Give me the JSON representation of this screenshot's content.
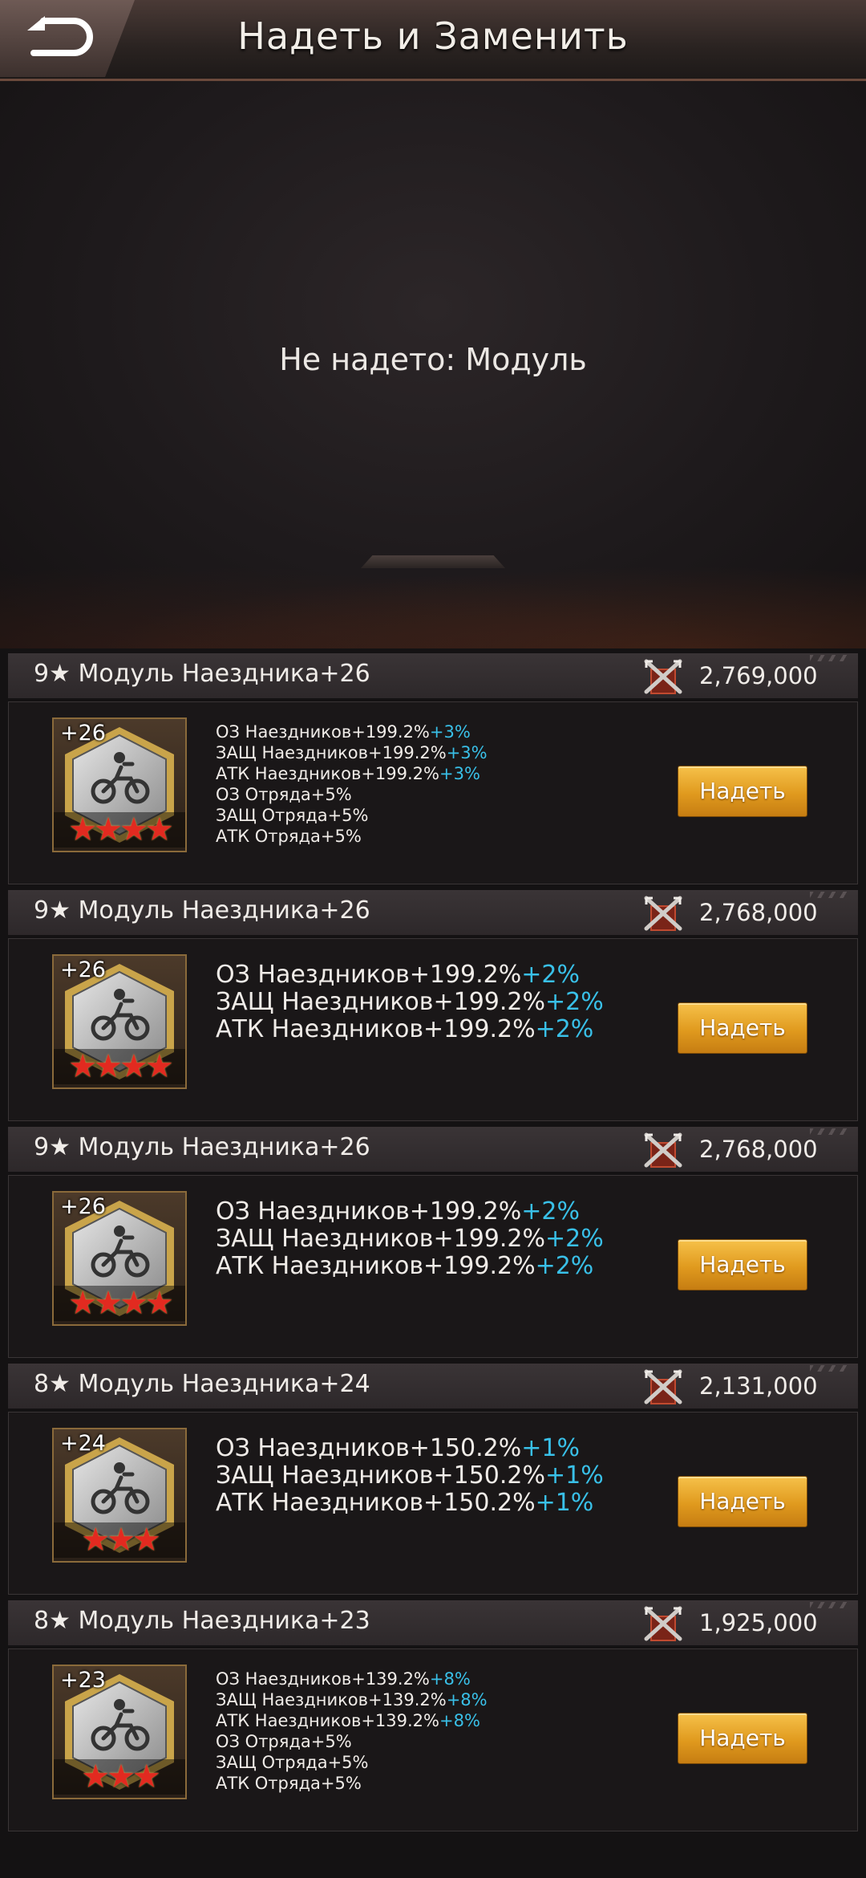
{
  "header": {
    "title": "Надеть и Заменить",
    "back_icon": "back-arrow-icon"
  },
  "slot": {
    "empty_text": "Не надето: Модуль"
  },
  "colors": {
    "bonus": "#39c0e8",
    "button": "#e8a52a",
    "stars": "#e22a20"
  },
  "cards": [
    {
      "name": "9★ Модуль Наездника+26",
      "power": "2,769,000",
      "level": "+26",
      "stars": "★★★★",
      "stats": [
        {
          "text": "ОЗ Наездников+199.2%",
          "bonus": "+3%"
        },
        {
          "text": "ЗАЩ Наездников+199.2%",
          "bonus": "+3%"
        },
        {
          "text": "АТК Наездников+199.2%",
          "bonus": "+3%"
        },
        {
          "text": "ОЗ Отряда+5%",
          "bonus": ""
        },
        {
          "text": "ЗАЩ Отряда+5%",
          "bonus": ""
        },
        {
          "text": "АТК Отряда+5%",
          "bonus": ""
        }
      ],
      "button": "Надеть"
    },
    {
      "name": "9★ Модуль Наездника+26",
      "power": "2,768,000",
      "level": "+26",
      "stars": "★★★★",
      "stats": [
        {
          "text": "ОЗ Наездников+199.2%",
          "bonus": "+2%"
        },
        {
          "text": "ЗАЩ Наездников+199.2%",
          "bonus": "+2%"
        },
        {
          "text": "АТК Наездников+199.2%",
          "bonus": "+2%"
        }
      ],
      "button": "Надеть"
    },
    {
      "name": "9★ Модуль Наездника+26",
      "power": "2,768,000",
      "level": "+26",
      "stars": "★★★★",
      "stats": [
        {
          "text": "ОЗ Наездников+199.2%",
          "bonus": "+2%"
        },
        {
          "text": "ЗАЩ Наездников+199.2%",
          "bonus": "+2%"
        },
        {
          "text": "АТК Наездников+199.2%",
          "bonus": "+2%"
        }
      ],
      "button": "Надеть"
    },
    {
      "name": "8★ Модуль Наездника+24",
      "power": "2,131,000",
      "level": "+24",
      "stars": "★★★",
      "stats": [
        {
          "text": "ОЗ Наездников+150.2%",
          "bonus": "+1%"
        },
        {
          "text": "ЗАЩ Наездников+150.2%",
          "bonus": "+1%"
        },
        {
          "text": "АТК Наездников+150.2%",
          "bonus": "+1%"
        }
      ],
      "button": "Надеть"
    },
    {
      "name": "8★ Модуль Наездника+23",
      "power": "1,925,000",
      "level": "+23",
      "stars": "★★★",
      "stats": [
        {
          "text": "ОЗ Наездников+139.2%",
          "bonus": "+8%"
        },
        {
          "text": "ЗАЩ Наездников+139.2%",
          "bonus": "+8%"
        },
        {
          "text": "АТК Наездников+139.2%",
          "bonus": "+8%"
        },
        {
          "text": "ОЗ Отряда+5%",
          "bonus": ""
        },
        {
          "text": "ЗАЩ Отряда+5%",
          "bonus": ""
        },
        {
          "text": "АТК Отряда+5%",
          "bonus": ""
        }
      ],
      "button": "Надеть"
    }
  ]
}
